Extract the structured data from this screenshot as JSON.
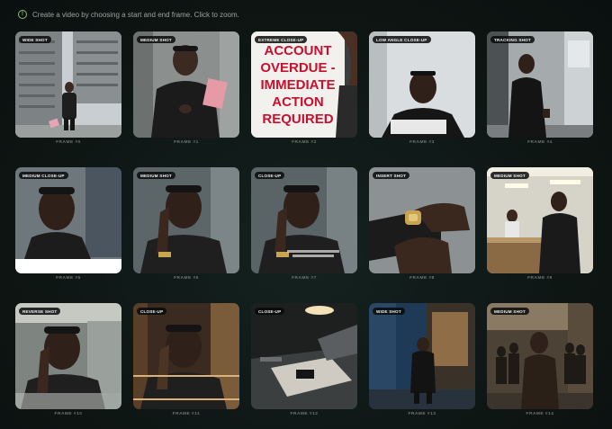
{
  "hint": {
    "text": "Create a video by choosing a start and end frame. Click to zoom."
  },
  "frames": [
    {
      "badge": "WIDE SHOT",
      "caption": "FRAME #0"
    },
    {
      "badge": "MEDIUM SHOT",
      "caption": "FRAME #1"
    },
    {
      "badge": "EXTREME CLOSE-UP",
      "caption": "FRAME #2",
      "sign_text": "ACCOUNT OVERDUE - IMMEDIATE ACTION REQUIRED"
    },
    {
      "badge": "LOW ANGLE CLOSE-UP",
      "caption": "FRAME #3"
    },
    {
      "badge": "TRACKING SHOT",
      "caption": "FRAME #4"
    },
    {
      "badge": "MEDIUM CLOSE-UP",
      "caption": "FRAME #5"
    },
    {
      "badge": "MEDIUM SHOT",
      "caption": "FRAME #6"
    },
    {
      "badge": "CLOSE-UP",
      "caption": "FRAME #7"
    },
    {
      "badge": "INSERT SHOT",
      "caption": "FRAME #8"
    },
    {
      "badge": "MEDIUM SHOT",
      "caption": "FRAME #9"
    },
    {
      "badge": "REVERSE SHOT",
      "caption": "FRAME #10"
    },
    {
      "badge": "CLOSE-UP",
      "caption": "FRAME #11"
    },
    {
      "badge": "CLOSE-UP",
      "caption": "FRAME #12"
    },
    {
      "badge": "WIDE SHOT",
      "caption": "FRAME #13"
    },
    {
      "badge": "MEDIUM SHOT",
      "caption": "FRAME #14"
    }
  ],
  "colors": {
    "background": "#0f1614",
    "hint_icon": "#8fbf6a",
    "caption": "#6e7773",
    "sign_text": "#c8102e"
  }
}
